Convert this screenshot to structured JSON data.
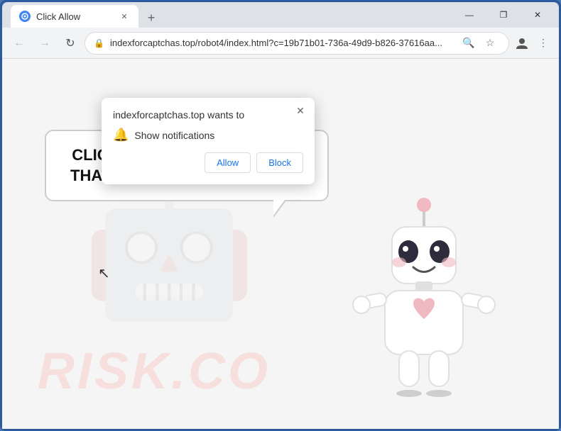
{
  "window": {
    "title": "Click Allow",
    "tab_label": "Click Allow",
    "new_tab_tooltip": "New tab"
  },
  "controls": {
    "minimize": "—",
    "restore": "❐",
    "close": "✕"
  },
  "nav": {
    "back": "←",
    "forward": "→",
    "refresh": "↻",
    "address": "indexforcaptchas.top/robot4/index.html?c=19b71b01-736a-49d9-b826-37616aa...",
    "search_icon": "🔍",
    "star_icon": "☆",
    "profile_icon": "👤",
    "menu_icon": "⋮"
  },
  "permission_dialog": {
    "title": "indexforcaptchas.top wants to",
    "notification_label": "Show notifications",
    "allow_btn": "Allow",
    "block_btn": "Block"
  },
  "page": {
    "bubble_text": "CLICK «ALLOW» TO CONFIRM THAT YOU ARE NOT A ROBOT!",
    "watermark": "RISK.CO"
  }
}
